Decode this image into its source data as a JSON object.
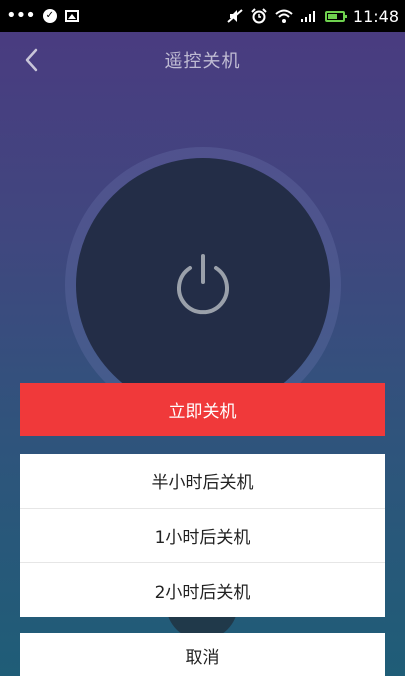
{
  "statusbar": {
    "time": "11:48",
    "icons": [
      "more-dots-icon",
      "check-circle-icon",
      "image-icon",
      "mute-icon",
      "alarm-icon",
      "wifi-icon",
      "signal-icon",
      "battery-icon"
    ]
  },
  "header": {
    "title": "遥控关机",
    "back_icon": "chevron-left-icon"
  },
  "power": {
    "icon": "power-icon"
  },
  "sheet": {
    "primary_label": "立即关机",
    "options": [
      {
        "label": "半小时后关机"
      },
      {
        "label": "1小时后关机"
      },
      {
        "label": "2小时后关机"
      }
    ],
    "cancel_label": "取消"
  },
  "colors": {
    "primary": "#f0393a",
    "battery": "#6fd14f"
  }
}
